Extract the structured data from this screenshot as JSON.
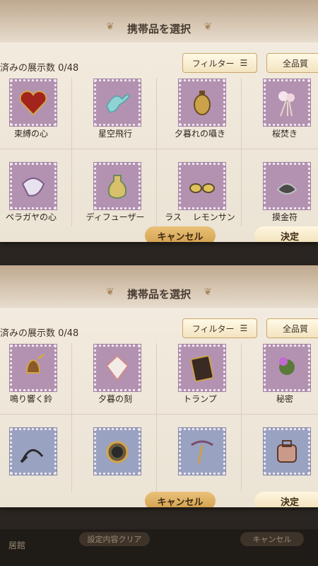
{
  "panels": [
    {
      "title": "携帯品を選択",
      "count": "済みの展示数 0/48",
      "filter_label": "フィルター",
      "quality_label": "全品質",
      "cancel_label": "キャンセル",
      "ok_label": "決定",
      "items": [
        {
          "label": "束縛の心",
          "icon": "heart-icon",
          "color": "purple"
        },
        {
          "label": "星空飛行",
          "icon": "bird-icon",
          "color": "purple"
        },
        {
          "label": "夕暮れの囁き",
          "icon": "lantern-icon",
          "color": "purple"
        },
        {
          "label": "桜焚き",
          "icon": "blossom-icon",
          "color": "purple"
        },
        {
          "label": "ペラガヤの心",
          "icon": "crystal-icon",
          "color": "purple"
        },
        {
          "label": "ディフューザー",
          "icon": "bottle-icon",
          "color": "purple"
        },
        {
          "label": "ラス　 レモンサン",
          "icon": "sunglasses-icon",
          "color": "purple"
        },
        {
          "label": "摸金符",
          "icon": "talisman-icon",
          "color": "purple"
        }
      ]
    },
    {
      "title": "携帯品を選択",
      "count": "済みの展示数 0/48",
      "filter_label": "フィルター",
      "quality_label": "全品質",
      "cancel_label": "キャンセル",
      "ok_label": "決定",
      "items": [
        {
          "label": "鳴り響く鈴",
          "icon": "bell-icon",
          "color": "purple"
        },
        {
          "label": "夕暮の刻",
          "icon": "gem-icon",
          "color": "purple"
        },
        {
          "label": "トランプ",
          "icon": "cards-icon",
          "color": "purple"
        },
        {
          "label": "秘密",
          "icon": "thistle-icon",
          "color": "purple"
        },
        {
          "label": "",
          "icon": "whip-icon",
          "color": "blue"
        },
        {
          "label": "",
          "icon": "compass-icon",
          "color": "blue"
        },
        {
          "label": "",
          "icon": "pendant-icon",
          "color": "blue"
        },
        {
          "label": "",
          "icon": "bag-icon",
          "color": "blue"
        }
      ]
    }
  ],
  "bottom": {
    "label": "居館",
    "clear_label": "設定内容クリア",
    "cancel_label": "キャンセル"
  }
}
